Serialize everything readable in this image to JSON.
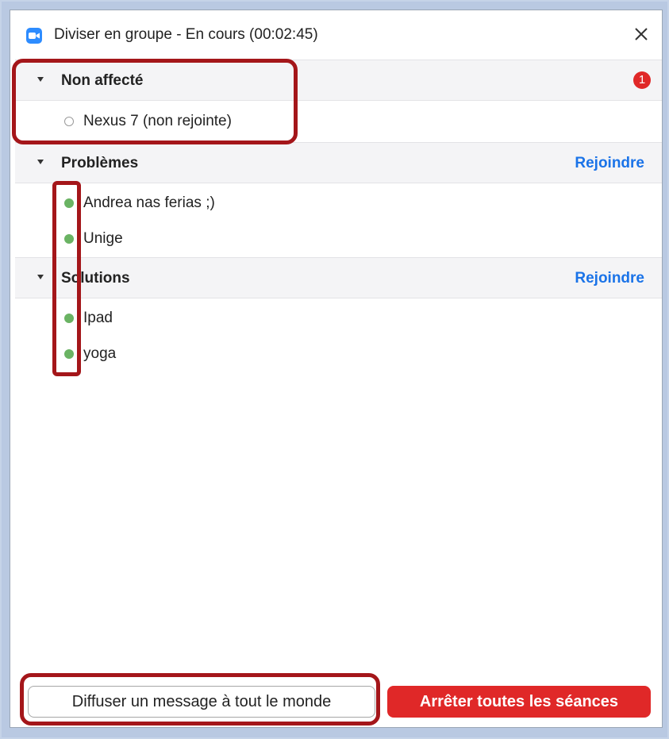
{
  "window": {
    "title": "Diviser en groupe - En cours (00:02:45)",
    "icon": "zoom-camera-icon",
    "close_icon": "close-icon"
  },
  "groups": [
    {
      "name": "Non affecté",
      "badge": "1",
      "members": [
        {
          "name": "Nexus 7 (non rejointe)",
          "status": "not-joined"
        }
      ]
    },
    {
      "name": "Problèmes",
      "action": "Rejoindre",
      "members": [
        {
          "name": "Andrea nas ferias ;)",
          "status": "joined"
        },
        {
          "name": "Unige",
          "status": "joined"
        }
      ]
    },
    {
      "name": "Solutions",
      "action": "Rejoindre",
      "members": [
        {
          "name": "Ipad",
          "status": "joined"
        },
        {
          "name": "yoga",
          "status": "joined"
        }
      ]
    }
  ],
  "footer": {
    "broadcast_label": "Diffuser un message à tout le monde",
    "stop_label": "Arrêter toutes les séances"
  },
  "colors": {
    "accent_blue": "#1a73e8",
    "stop_red": "#e02828",
    "joined_green": "#6ab363",
    "highlight": "#a4161a"
  }
}
